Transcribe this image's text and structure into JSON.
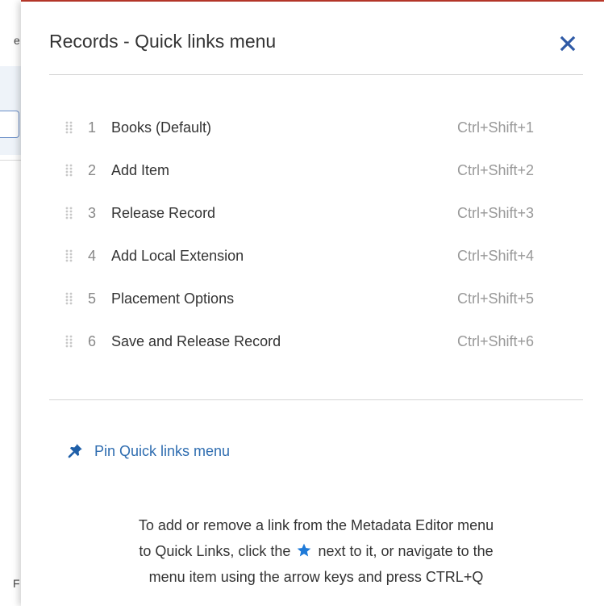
{
  "background": {
    "edge_chars": [
      "e",
      "F"
    ]
  },
  "panel": {
    "title": "Records - Quick links menu",
    "close_icon": "close-icon",
    "accent_color": "#2f6db0"
  },
  "quick_links": [
    {
      "number": "1",
      "label": "Books (Default)",
      "shortcut": "Ctrl+Shift+1"
    },
    {
      "number": "2",
      "label": "Add Item",
      "shortcut": "Ctrl+Shift+2"
    },
    {
      "number": "3",
      "label": "Release Record",
      "shortcut": "Ctrl+Shift+3"
    },
    {
      "number": "4",
      "label": "Add Local Extension",
      "shortcut": "Ctrl+Shift+4"
    },
    {
      "number": "5",
      "label": "Placement Options",
      "shortcut": "Ctrl+Shift+5"
    },
    {
      "number": "6",
      "label": "Save and Release Record",
      "shortcut": "Ctrl+Shift+6"
    }
  ],
  "pin": {
    "label": "Pin Quick links menu",
    "icon": "pin-icon"
  },
  "help": {
    "line1": "To add or remove a link from the Metadata Editor menu",
    "line2_before": "to Quick Links, click the",
    "line2_after": "next to it, or navigate to the",
    "line3": "menu item using the arrow keys and press CTRL+Q",
    "star_icon": "star-icon"
  }
}
